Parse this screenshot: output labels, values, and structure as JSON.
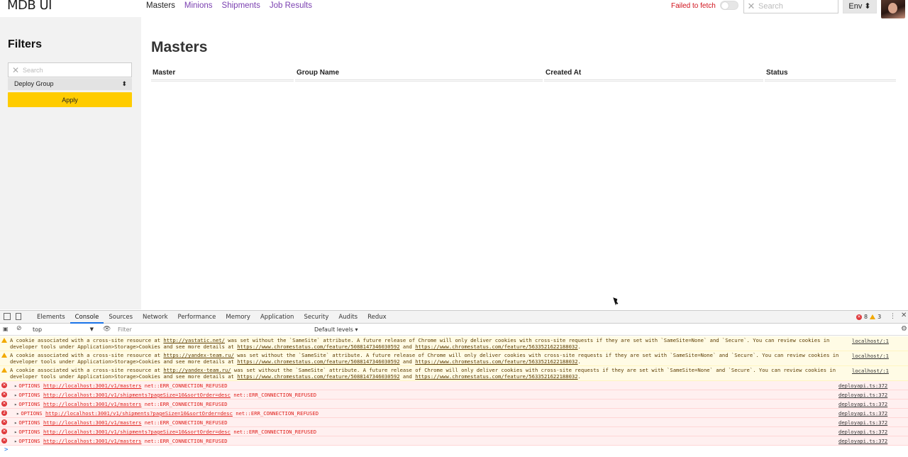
{
  "app": {
    "brand": "MDB UI",
    "nav": [
      {
        "label": "Masters",
        "active": true
      },
      {
        "label": "Minions",
        "active": false
      },
      {
        "label": "Shipments",
        "active": false
      },
      {
        "label": "Job Results",
        "active": false
      }
    ],
    "fetch_status": "Failed to fetch",
    "search_placeholder": "Search",
    "env_label": "Env",
    "accent_color": "#ffcc00",
    "link_color": "#7a3fb0"
  },
  "sidebar": {
    "title": "Filters",
    "search_placeholder": "Search",
    "deploy_group_label": "Deploy Group",
    "apply_label": "Apply"
  },
  "main": {
    "title": "Masters",
    "columns": [
      "Master",
      "Group Name",
      "Created At",
      "Status"
    ]
  },
  "devtools": {
    "tabs": [
      "Elements",
      "Console",
      "Sources",
      "Network",
      "Performance",
      "Memory",
      "Application",
      "Security",
      "Audits",
      "Redux"
    ],
    "active_tab": "Console",
    "error_count": "8",
    "warning_count": "3",
    "context": "top",
    "filter_placeholder": "Filter",
    "levels": "Default levels",
    "warnings": [
      {
        "pre": "A cookie associated with a cross-site resource at ",
        "link": "http://yastatic.net/",
        "post": " was set without the `SameSite` attribute. A future release of Chrome will only deliver cookies with cross-site requests if they are set with `SameSite=None` and `Secure`. You can review cookies in developer tools under Application>Storage>Cookies and see more details at ",
        "link2": "https://www.chromestatus.com/feature/5088147346030592",
        "and": " and ",
        "link3": "https://www.chromestatus.com/feature/5633521622188032",
        "end": ".",
        "source": "localhost/:1"
      },
      {
        "pre": "A cookie associated with a cross-site resource at ",
        "link": "https://yandex-team.ru/",
        "post": " was set without the `SameSite` attribute. A future release of Chrome will only deliver cookies with cross-site requests if they are set with `SameSite=None` and `Secure`. You can review cookies in developer tools under Application>Storage>Cookies and see more details at ",
        "link2": "https://www.chromestatus.com/feature/5088147346030592",
        "and": " and ",
        "link3": "https://www.chromestatus.com/feature/5633521622188032",
        "end": ".",
        "source": "localhost/:1"
      },
      {
        "pre": "A cookie associated with a cross-site resource at ",
        "link": "http://yandex-team.ru/",
        "post": " was set without the `SameSite` attribute. A future release of Chrome will only deliver cookies with cross-site requests if they are set with `SameSite=None` and `Secure`. You can review cookies in developer tools under Application>Storage>Cookies and see more details at ",
        "link2": "https://www.chromestatus.com/feature/5088147346030592",
        "and": " and ",
        "link3": "https://www.chromestatus.com/feature/5633521622188032",
        "end": ".",
        "source": "localhost/:1"
      }
    ],
    "errors": [
      {
        "badge": "",
        "method": "OPTIONS",
        "url": "http://localhost:3001/v1/masters",
        "error": "net::ERR_CONNECTION_REFUSED",
        "source": "deployapi.ts:372"
      },
      {
        "badge": "",
        "method": "OPTIONS",
        "url": "http://localhost:3001/v1/shipments?pageSize=10&sortOrder=desc",
        "error": "net::ERR_CONNECTION_REFUSED",
        "source": "deployapi.ts:372"
      },
      {
        "badge": "",
        "method": "OPTIONS",
        "url": "http://localhost:3001/v1/masters",
        "error": "net::ERR_CONNECTION_REFUSED",
        "source": "deployapi.ts:372"
      },
      {
        "badge": "2",
        "method": "OPTIONS",
        "url": "http://localhost:3001/v1/shipments?pageSize=10&sortOrder=desc",
        "error": "net::ERR_CONNECTION_REFUSED",
        "source": "deployapi.ts:372"
      },
      {
        "badge": "",
        "method": "OPTIONS",
        "url": "http://localhost:3001/v1/masters",
        "error": "net::ERR_CONNECTION_REFUSED",
        "source": "deployapi.ts:372"
      },
      {
        "badge": "",
        "method": "OPTIONS",
        "url": "http://localhost:3001/v1/shipments?pageSize=10&sortOrder=desc",
        "error": "net::ERR_CONNECTION_REFUSED",
        "source": "deployapi.ts:372"
      },
      {
        "badge": "",
        "method": "OPTIONS",
        "url": "http://localhost:3001/v1/masters",
        "error": "net::ERR_CONNECTION_REFUSED",
        "source": "deployapi.ts:372"
      }
    ],
    "prompt": ">"
  }
}
